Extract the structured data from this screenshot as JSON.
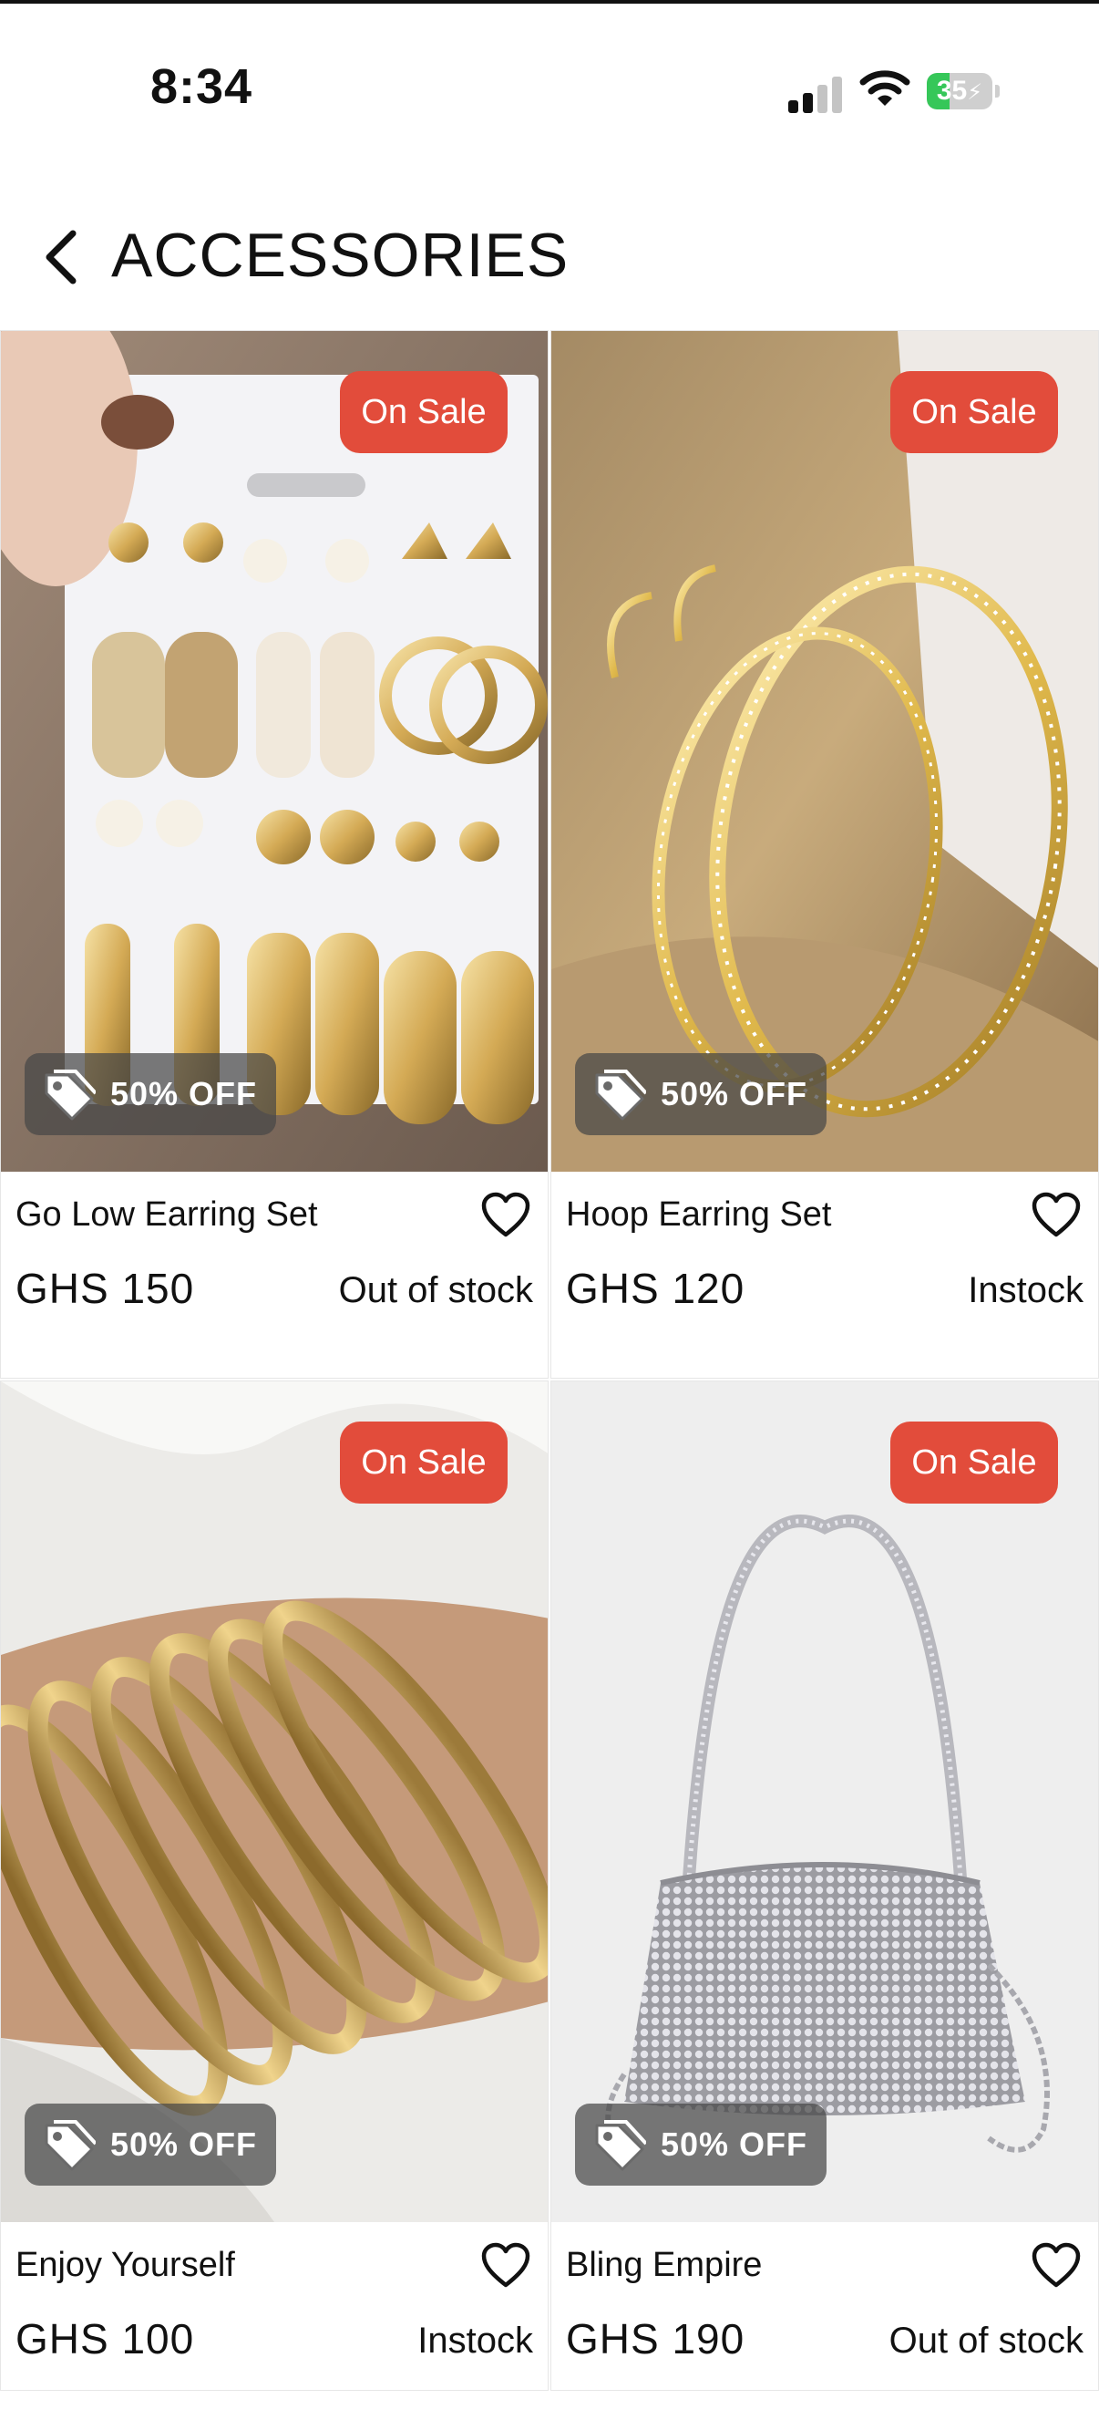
{
  "status_bar": {
    "time": "8:34",
    "battery_level": "35",
    "battery_fraction": 0.35,
    "signal_bars_active": 2,
    "signal_bars_total": 4
  },
  "header": {
    "title": "ACCESSORIES",
    "back_icon": "chevron-left-icon"
  },
  "colors": {
    "sale_badge": "#e24c3b",
    "battery_green": "#36c759",
    "discount_badge_bg": "rgba(70,70,70,0.72)"
  },
  "products": [
    {
      "name": "Go Low Earring Set",
      "price": "GHS 150",
      "stock": "Out of stock",
      "sale_label": "On Sale",
      "discount_label": "50% OFF",
      "image": "earring-set-photo",
      "favorite_icon": "heart-outline-icon"
    },
    {
      "name": "Hoop Earring Set",
      "price": "GHS 120",
      "stock": "Instock",
      "sale_label": "On Sale",
      "discount_label": "50% OFF",
      "image": "gold-hoop-earrings-photo",
      "favorite_icon": "heart-outline-icon"
    },
    {
      "name": "Enjoy Yourself",
      "price": "GHS 100",
      "stock": "Instock",
      "sale_label": "On Sale",
      "discount_label": "50% OFF",
      "image": "gold-bangles-photo",
      "favorite_icon": "heart-outline-icon"
    },
    {
      "name": "Bling Empire",
      "price": "GHS 190",
      "stock": "Out of stock",
      "sale_label": "On Sale",
      "discount_label": "50% OFF",
      "image": "rhinestone-bag-photo",
      "favorite_icon": "heart-outline-icon"
    }
  ]
}
